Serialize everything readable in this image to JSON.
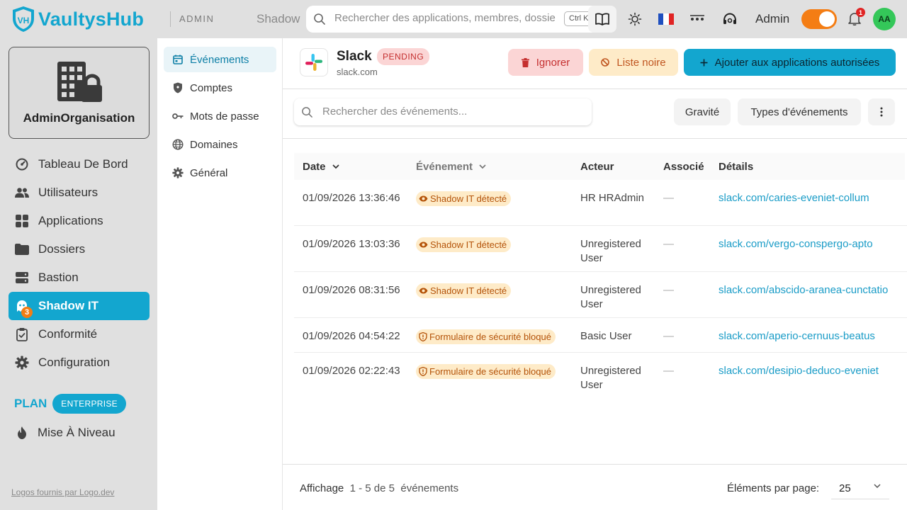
{
  "brand": {
    "name": "VaultysHub",
    "logo_text": "VH",
    "area": "ADMIN",
    "accent": "#13a6cf"
  },
  "topbar": {
    "crumb": "Shadow",
    "search_placeholder": "Rechercher des applications, membres, dossiers...",
    "shortcut": "Ctrl K",
    "user_label": "Admin",
    "notifications": "1",
    "avatar_initials": "AA",
    "icons": [
      "book-icon",
      "sun-icon",
      "flag-fr-icon",
      "password-icon",
      "support-icon",
      "bell-icon"
    ]
  },
  "sidebar": {
    "org_name": "AdminOrganisation",
    "items": [
      {
        "label": "Tableau De Bord",
        "icon": "dashboard-icon"
      },
      {
        "label": "Utilisateurs",
        "icon": "users-icon"
      },
      {
        "label": "Applications",
        "icon": "apps-icon"
      },
      {
        "label": "Dossiers",
        "icon": "folder-icon"
      },
      {
        "label": "Bastion",
        "icon": "server-icon"
      },
      {
        "label": "Shadow IT",
        "icon": "ghost-icon",
        "badge": "3",
        "active": true
      },
      {
        "label": "Conformité",
        "icon": "clipboard-icon"
      },
      {
        "label": "Configuration",
        "icon": "gear-icon"
      }
    ],
    "plan_label": "PLAN",
    "plan_value": "ENTERPRISE",
    "upgrade_label": "Mise À Niveau",
    "credit": "Logos fournis par Logo.dev"
  },
  "subnav": {
    "items": [
      {
        "label": "Événements",
        "icon": "calendar-icon",
        "active": true
      },
      {
        "label": "Comptes",
        "icon": "shield-icon"
      },
      {
        "label": "Mots de passe",
        "icon": "key-icon"
      },
      {
        "label": "Domaines",
        "icon": "globe-icon"
      },
      {
        "label": "Général",
        "icon": "gear-icon"
      }
    ]
  },
  "app": {
    "name": "Slack",
    "status": "PENDING",
    "domain": "slack.com",
    "actions": {
      "ignore": "Ignorer",
      "blacklist": "Liste noire",
      "authorize": "Ajouter aux applications autorisées"
    }
  },
  "filters": {
    "search_placeholder": "Rechercher des événements...",
    "severity": "Gravité",
    "event_types": "Types d'événements"
  },
  "table": {
    "columns": {
      "date": "Date",
      "event": "Événement",
      "actor": "Acteur",
      "associated": "Associé",
      "details": "Détails"
    },
    "rows": [
      {
        "date": "01/09/2026 13:36:46",
        "event": "Shadow IT détecté",
        "event_icon": "eye-icon",
        "actor": "HR HRAdmin",
        "associated": "—",
        "details": "slack.com/caries-eveniet-collum"
      },
      {
        "date": "01/09/2026 13:03:36",
        "event": "Shadow IT détecté",
        "event_icon": "eye-icon",
        "actor": "Unregistered User",
        "associated": "—",
        "details": "slack.com/vergo-conspergo-apto"
      },
      {
        "date": "01/09/2026 08:31:56",
        "event": "Shadow IT détecté",
        "event_icon": "eye-icon",
        "actor": "Unregistered User",
        "associated": "—",
        "details": "slack.com/abscido-aranea-cunctatio"
      },
      {
        "date": "01/09/2026 04:54:22",
        "event": "Formulaire de sécurité bloqué",
        "event_icon": "shield-alert-icon",
        "actor": "Basic User",
        "associated": "—",
        "details": "slack.com/aperio-cernuus-beatus"
      },
      {
        "date": "01/09/2026 02:22:43",
        "event": "Formulaire de sécurité bloqué",
        "event_icon": "shield-alert-icon",
        "actor": "Unregistered User",
        "associated": "—",
        "details": "slack.com/desipio-deduco-eveniet"
      }
    ]
  },
  "footer": {
    "showing_label": "Affichage",
    "range": "1 - 5 de 5",
    "unit": "événements",
    "per_page_label": "Éléments par page:",
    "per_page_value": "25"
  }
}
